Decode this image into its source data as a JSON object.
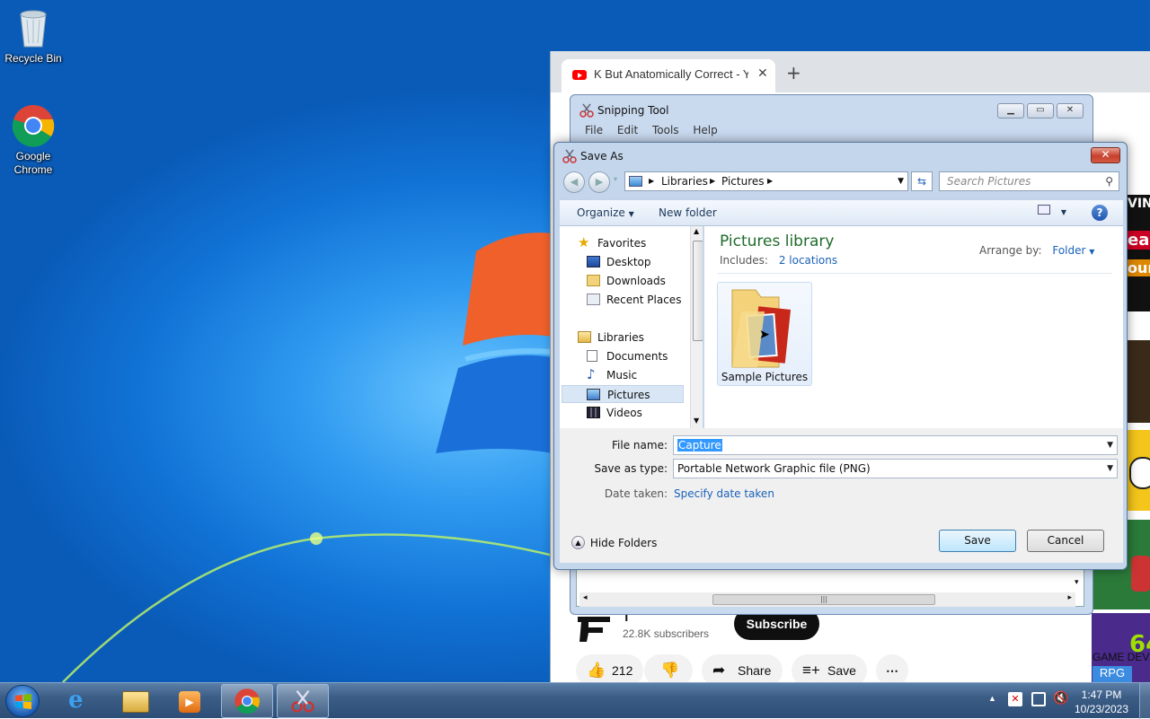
{
  "desktop": {
    "icons": [
      {
        "label": "Recycle Bin"
      },
      {
        "label": "Google Chrome"
      }
    ]
  },
  "browser": {
    "tab_title": "K But Anatomically Correct - You",
    "tab_close": "✕",
    "new_tab": "+",
    "channel_initial": "T",
    "subscribers": "22.8K subscribers",
    "subscribe_label": "Subscribe",
    "like_count": "212",
    "share_label": "Share",
    "save_label": "Save",
    "more_label": "⋯",
    "side_texts": {
      "t1": "VIN",
      "t2": "eal",
      "t3": "our",
      "t4": "64",
      "t5": "GAME DEV",
      "t6": "RPG"
    }
  },
  "snipping_tool": {
    "title": "Snipping Tool",
    "menu": [
      "File",
      "Edit",
      "Tools",
      "Help"
    ],
    "hscroll_grip": "|||"
  },
  "save_as": {
    "title": "Save As",
    "close": "✕",
    "address": [
      "Libraries",
      "Pictures"
    ],
    "search_placeholder": "Search Pictures",
    "organize": "Organize",
    "new_folder": "New folder",
    "help": "?",
    "nav": {
      "favorites": "Favorites",
      "desktop": "Desktop",
      "downloads": "Downloads",
      "recent_places": "Recent Places",
      "libraries": "Libraries",
      "documents": "Documents",
      "music": "Music",
      "pictures": "Pictures",
      "videos": "Videos"
    },
    "library_title": "Pictures library",
    "includes_label": "Includes:",
    "includes_link": "2 locations",
    "arrange_by_label": "Arrange by:",
    "arrange_by_value": "Folder",
    "folder_item": "Sample Pictures",
    "file_name_label": "File name:",
    "file_name_value": "Capture",
    "save_type_label": "Save as type:",
    "save_type_value": "Portable Network Graphic file (PNG)",
    "date_taken_label": "Date taken:",
    "date_taken_link": "Specify date taken",
    "hide_folders": "Hide Folders",
    "save_button": "Save",
    "cancel_button": "Cancel"
  },
  "taskbar": {
    "time": "1:47 PM",
    "date": "10/23/2023"
  }
}
